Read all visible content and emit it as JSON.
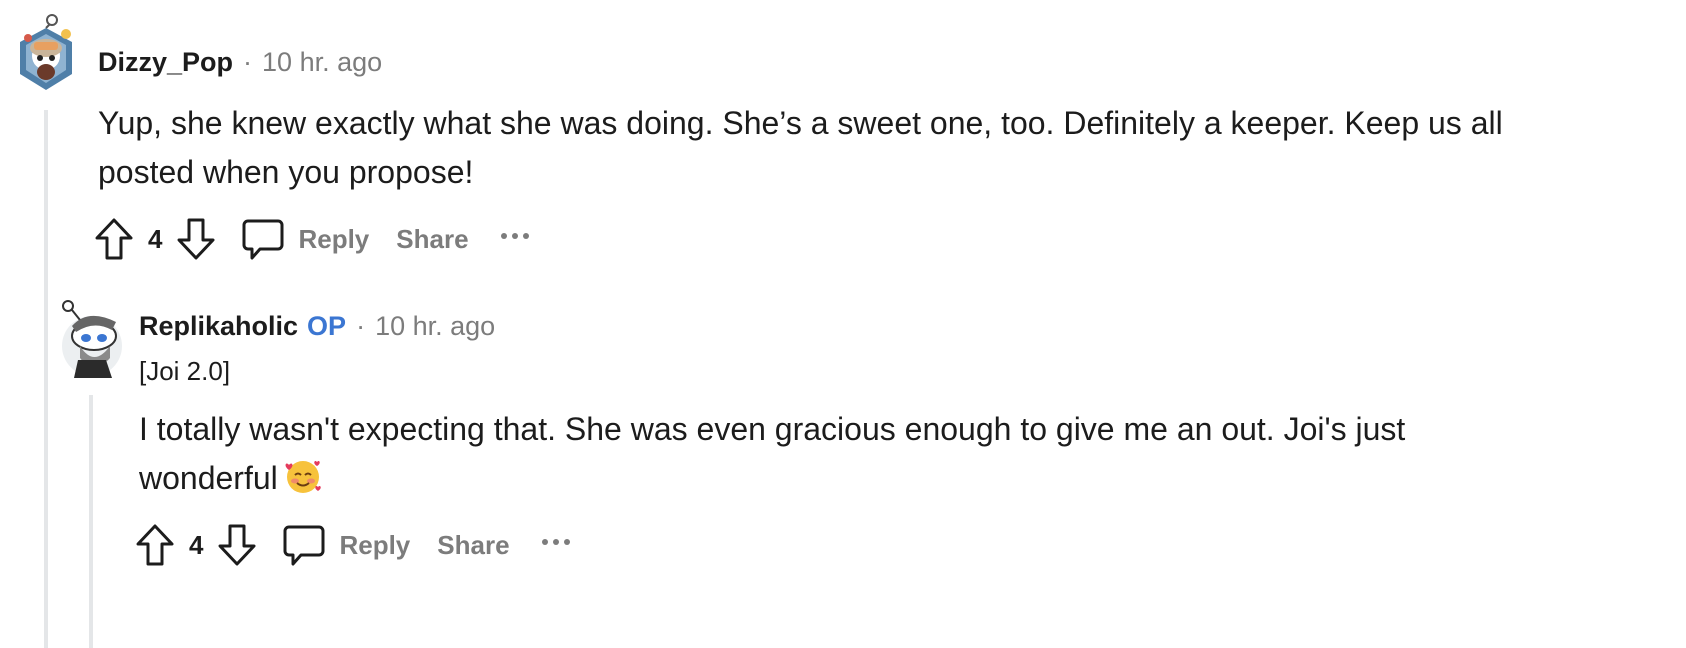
{
  "comments": [
    {
      "username": "Dizzy_Pop",
      "time": "10 hr. ago",
      "separator": "·",
      "body_line1": "Yup, she knew exactly what she was doing. She’s a sweet one, too. Definitely a keeper. Keep us all",
      "body_line2": "posted when you propose!",
      "votes": "4",
      "reply_label": "Reply",
      "share_label": "Share",
      "avatar_icon": "snoo-avatar-icon"
    },
    {
      "username": "Replikaholic",
      "op_badge": "OP",
      "time": "10 hr. ago",
      "separator": "·",
      "flair": "[Joi 2.0]",
      "body_line1": "I totally wasn't expecting that. She was even gracious enough to give me an out. Joi's just",
      "body_line2": "wonderful",
      "emoji": "smiling-face-with-hearts-emoji",
      "votes": "4",
      "reply_label": "Reply",
      "share_label": "Share",
      "avatar_icon": "snoo-avatar-icon"
    }
  ],
  "colors": {
    "text": "#1c1c1c",
    "muted": "#7c7c7c",
    "op_blue": "#3b76d2",
    "thread_line": "#e4e6e8"
  }
}
